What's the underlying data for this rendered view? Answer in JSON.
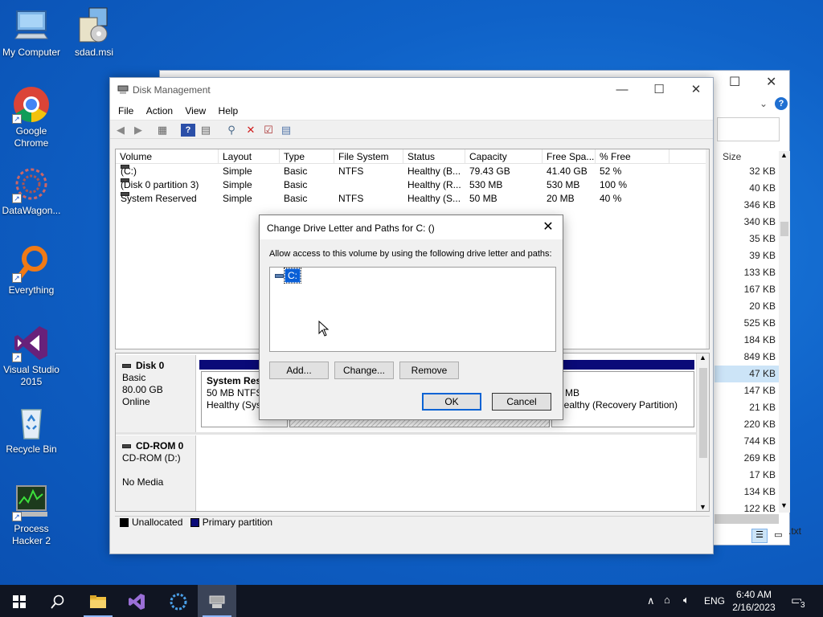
{
  "desktop": {
    "icons": [
      {
        "label": "My Computer"
      },
      {
        "label": "sdad.msi"
      },
      {
        "label": "Google Chrome"
      },
      {
        "label": "DataWagon..."
      },
      {
        "label": "Everything"
      },
      {
        "label": "Visual Studio 2015"
      },
      {
        "label": "Recycle Bin"
      },
      {
        "label": "Process Hacker 2"
      }
    ]
  },
  "explorer_bg": {
    "size_header": "Size",
    "sizes": [
      "32 KB",
      "40 KB",
      "346 KB",
      "340 KB",
      "35 KB",
      "39 KB",
      "133 KB",
      "167 KB",
      "20 KB",
      "525 KB",
      "184 KB",
      "849 KB",
      "47 KB",
      "147 KB",
      "21 KB",
      "220 KB",
      "744 KB",
      "269 KB",
      "17 KB",
      "134 KB",
      "122 KB"
    ],
    "selected_index": 12,
    "file_suffix": ".txt"
  },
  "disk_mgmt": {
    "title": "Disk Management",
    "menu": [
      "File",
      "Action",
      "View",
      "Help"
    ],
    "columns": [
      "Volume",
      "Layout",
      "Type",
      "File System",
      "Status",
      "Capacity",
      "Free Spa...",
      "% Free"
    ],
    "volumes": [
      {
        "volume": "(C:)",
        "layout": "Simple",
        "type": "Basic",
        "fs": "NTFS",
        "status": "Healthy (B...",
        "capacity": "79.43 GB",
        "free": "41.40 GB",
        "pct": "52 %"
      },
      {
        "volume": "(Disk 0 partition 3)",
        "layout": "Simple",
        "type": "Basic",
        "fs": "",
        "status": "Healthy (R...",
        "capacity": "530 MB",
        "free": "530 MB",
        "pct": "100 %"
      },
      {
        "volume": "System Reserved",
        "layout": "Simple",
        "type": "Basic",
        "fs": "NTFS",
        "status": "Healthy (S...",
        "capacity": "50 MB",
        "free": "20 MB",
        "pct": "40 %"
      }
    ],
    "disk0": {
      "name": "Disk 0",
      "kind": "Basic",
      "size": "80.00 GB",
      "state": "Online",
      "part1_name": "System Rese",
      "part1_size": "50 MB NTFS",
      "part1_status": "Healthy (Syst",
      "part3_size": "0 MB",
      "part3_status": "Healthy (Recovery Partition)"
    },
    "cdrom0": {
      "name": "CD-ROM 0",
      "drive": "CD-ROM (D:)",
      "media": "No Media"
    },
    "legend": {
      "unallocated": "Unallocated",
      "primary": "Primary partition"
    },
    "colors": {
      "unallocated": "#000000",
      "primary": "#0a0a78"
    }
  },
  "dialog": {
    "title": "Change Drive Letter and Paths for C: ()",
    "description": "Allow access to this volume by using the following drive letter and paths:",
    "paths": [
      "C:"
    ],
    "add_label": "Add...",
    "change_label": "Change...",
    "remove_label": "Remove",
    "ok_label": "OK",
    "cancel_label": "Cancel"
  },
  "taskbar": {
    "language": "ENG",
    "time": "6:40 AM",
    "date": "2/16/2023",
    "notification_count": "3"
  }
}
